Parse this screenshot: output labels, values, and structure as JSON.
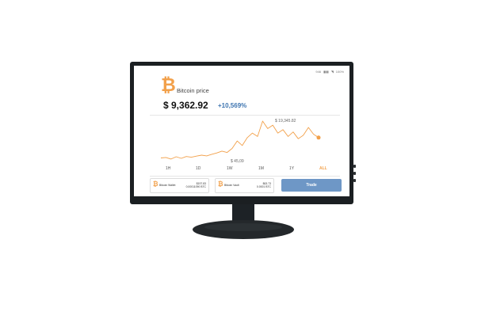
{
  "status_bar": {
    "carrier": "946",
    "signal_icon": "signal-icon",
    "wifi_icon": "wifi-icon",
    "battery": "100%"
  },
  "header": {
    "logo_icon": "bitcoin-icon",
    "title": "Bitcoin price"
  },
  "price": {
    "value": "$ 9,362.92",
    "change": "+10,569%"
  },
  "chart_labels": {
    "max": "$ 19,345.82",
    "min": "$ 45,09"
  },
  "periods": [
    "1H",
    "1D",
    "1W",
    "1M",
    "1Y",
    "ALL"
  ],
  "selected_period": "ALL",
  "wallets": [
    {
      "name": "Bitcoin Wallet",
      "amount": "$197.83",
      "sub": "0.00011090 BTC"
    },
    {
      "name": "Bitcoin Vault",
      "amount": "$63.73",
      "sub": "0.0001 BTC"
    }
  ],
  "trade_button": "Trade",
  "chart_data": {
    "type": "line",
    "title": "",
    "xlabel": "",
    "ylabel": "",
    "series": [
      {
        "values": [
          3.0,
          3.2,
          2.5,
          3.5,
          2.8,
          3.6,
          3.3,
          3.8,
          4.2,
          3.9,
          4.6,
          5.2,
          6.0,
          5.4,
          7.2,
          10.5,
          8.5,
          12.0,
          14.0,
          12.5,
          19.3,
          16.0,
          17.5,
          14.0,
          15.5,
          12.5,
          14.5,
          11.5,
          13.0,
          16.5,
          13.5,
          12.0
        ]
      }
    ],
    "annotations": [
      "$ 19,345.82",
      "$ 45,09"
    ],
    "color": "#f2a04a",
    "grid": false
  }
}
